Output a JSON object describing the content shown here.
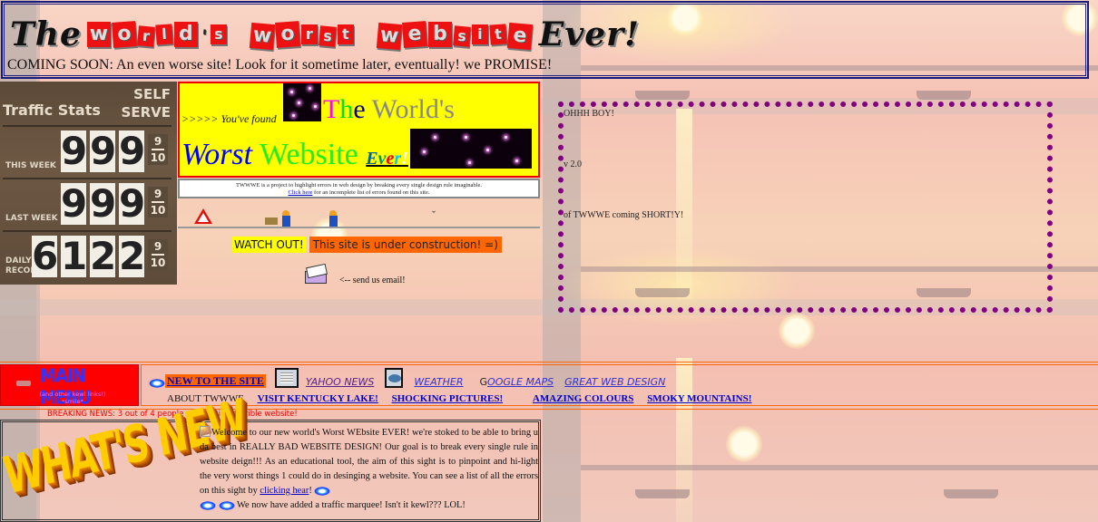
{
  "header": {
    "title_the": "The",
    "title_ransom": [
      "w",
      "o",
      "r",
      "l",
      "d",
      "'",
      "s",
      " ",
      "w",
      "o",
      "r",
      "s",
      "t",
      " ",
      "w",
      "e",
      "b",
      "s",
      "i",
      "t",
      "e"
    ],
    "title_ever": "Ever!",
    "coming_soon": "COMING SOON: An even worse site! Look for it sometime later, eventually!  we PROMISE!"
  },
  "traffic_stats": {
    "title": "Traffic Stats",
    "self_serve_line1": "SELF",
    "self_serve_line2": "SERVE",
    "rows": [
      {
        "label": "THIS WEEK",
        "digits": [
          "9",
          "9",
          "9"
        ],
        "fraction_num": "9",
        "fraction_den": "10"
      },
      {
        "label": "LAST WEEK",
        "digits": [
          "9",
          "9",
          "9"
        ],
        "fraction_num": "9",
        "fraction_den": "10"
      },
      {
        "label_line1": "DAILY",
        "label_line2": "RECOR",
        "digits": [
          "6",
          "1.",
          "2",
          "2"
        ],
        "fraction_num": "9",
        "fraction_den": "10"
      }
    ]
  },
  "banner": {
    "found": ">>>>> You've found",
    "the_t": "T",
    "the_h": "h",
    "the_e": "e",
    "worlds": "World's",
    "worst": "Worst",
    "website": "Website",
    "ever": [
      "E",
      "v",
      "e",
      "r",
      "!"
    ]
  },
  "info_box": {
    "line1": "TWWWE is a project to highlight errors in web design by breaking every single design rule imaginable.",
    "link": "Click here",
    "line2": " for an incomplete list of errors found on this site."
  },
  "construction": {
    "watch_out": "WATCH OUT!",
    "under_construction": "This site is under construction! =)",
    "bird": "ˇ"
  },
  "email": {
    "label": "<-- send us email!"
  },
  "dotted_box": {
    "line1": "OHHH BOY!",
    "line2": "v 2.0",
    "line3": "of TWWWE coming SHORT!Y!"
  },
  "main_menu": {
    "title": "MAIN MENU",
    "subtitle_line1": "(and other kewl links!)",
    "subtitle_line2": "*smile*"
  },
  "nav": {
    "new_to_site": "NEW TO THE SITE",
    "yahoo_news": "YAHOO NEWS",
    "weather": "WEATHER",
    "google_maps_g": "G",
    "google_maps_rest": "OOGLE MAPS",
    "great_web_design": "GREAT WEB DESIGN ",
    "about": "ABOUT TWWWE",
    "kentucky": "VISIT KENTUCKY LAKE!",
    "shocking": "SHOCKING PICTURES!",
    "colours": "AMAZING COLOURS",
    "smoky": "SMOKY MOUNTAINS!"
  },
  "breaking_news": "BREAKING NEWS:  3 out of 4 people say this is a terrible website!",
  "whats_new": {
    "title": "WHAT'S NEW",
    "para1": "Welcome to our new world's Worst WEbsite EVER!  we're stoked to be able to bring u da best in REALLY BAD WEBSITE DESIGN!  Our goal is to break every single rule in website deign!!!      As an educational tool, the aim of this sight is to pinpoint and hi-light the very worst things 1 could do in desinging a website.  You can see a list of all the errors on this sight by ",
    "link": "clicking hear",
    "after_link": "! ",
    "para2": " We now have added a traffic marquee!  Isn't it kewl??? LOL!"
  },
  "colors": {
    "header_border": "#1a1a7a",
    "banner_bg": "#ffff00",
    "banner_border": "#ee0000",
    "dotted_border": "#800080",
    "menu_red": "#ff0000",
    "nav_orange": "#ff6600",
    "link_blue": "#0000cc"
  }
}
